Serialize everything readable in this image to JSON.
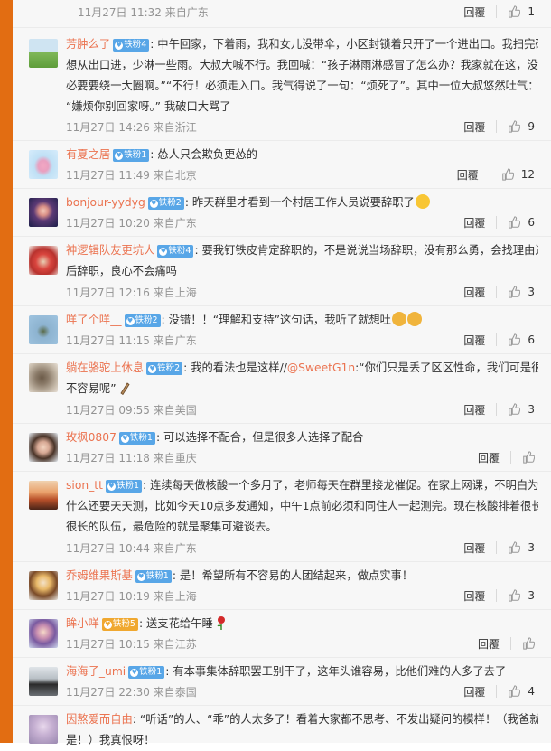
{
  "top_item": {
    "meta": "11月27日 11:32 来自广东",
    "reply": "回覆",
    "likes": "1"
  },
  "comments": [
    {
      "user": "芳肿么了",
      "badge": "铁粉4",
      "lines": [
        ": 中午回家，下着雨，我和女儿没带伞，小区封锁着只开了一个进出口。我扫完码",
        "想从出口进，少淋一些雨。大叔大喊不行。我回喊：“孩子淋雨淋感冒了怎么办？我家就在这，没",
        "必要要绕一大圈啊。”“不行！必须走入口。我气得说了一句：“烦死了”。其中一位大叔悠然吐气：",
        "“嫌烦你别回家呀。” 我破口大骂了"
      ],
      "meta": "11月27日 14:26 来自浙江",
      "reply": "回覆",
      "likes": "9"
    },
    {
      "user": "有夏之居",
      "badge": "铁粉1",
      "lines": [
        ": 怂人只会欺负更怂的"
      ],
      "meta": "11月27日 11:49 来自北京",
      "reply": "回覆",
      "likes": "12"
    },
    {
      "user": "bonjour-yydyg",
      "badge": "铁粉2",
      "lines": [
        ": 昨天群里才看到一个村居工作人员说要辞职了"
      ],
      "meta": "11月27日 10:20 来自广东",
      "reply": "回覆",
      "likes": "6"
    },
    {
      "user": "神逻辑队友更坑人",
      "badge": "铁粉4",
      "lines": [
        ": 要我钉铁皮肯定辞职的，不是说说当场辞职，没有那么勇，会找理由过",
        "后辞职，良心不会痛吗"
      ],
      "meta": "11月27日 12:16 来自上海",
      "reply": "回覆",
      "likes": "3"
    },
    {
      "user": "咩了个咩__",
      "badge": "铁粉2",
      "lines": [
        ": 没错！！“理解和支持”这句话，我听了就想吐"
      ],
      "meta": "11月27日 11:15 来自广东",
      "reply": "回覆",
      "likes": "6"
    },
    {
      "user": "躺在骆驼上休息",
      "badge": "铁粉2",
      "lines_rich": [
        ": 我的看法也是这样//",
        "@SweetG1n",
        ":“你们只是丢了区区性命，我们可是很"
      ],
      "lines": [
        "不容易呢”"
      ],
      "meta": "11月27日 09:55 来自美国",
      "reply": "回覆",
      "likes": "3"
    },
    {
      "user": "玫枫0807",
      "badge": "铁粉1",
      "lines": [
        ": 可以选择不配合，但是很多人选择了配合"
      ],
      "meta": "11月27日 11:18 来自重庆",
      "reply": "回覆",
      "likes": ""
    },
    {
      "user": "sion_tt",
      "badge": "铁粉1",
      "lines": [
        ": 连续每天做核酸一个多月了，老师每天在群里接龙催促。在家上网课，不明白为",
        "什么还要天天测，比如今天10点多发通知，中午1点前必须和同住人一起测完。现在核酸排着很长",
        "很长的队伍，最危险的就是聚集可避谈去。"
      ],
      "meta": "11月27日 10:44 来自广东",
      "reply": "回覆",
      "likes": "3"
    },
    {
      "user": "乔姆维果斯基",
      "badge": "铁粉1",
      "lines": [
        ": 是！希望所有不容易的人团结起来，做点实事！"
      ],
      "meta": "11月27日 10:19 来自上海",
      "reply": "回覆",
      "likes": "3"
    },
    {
      "user": "眸小咩",
      "badge": "铁粉5",
      "lines": [
        ": 送支花给午睡"
      ],
      "meta": "11月27日 10:15 来自江苏",
      "reply": "回覆",
      "likes": ""
    },
    {
      "user": "海海子_umi",
      "badge": "铁粉1",
      "lines": [
        ": 有本事集体辞职罢工别干了，这年头谁容易，比他们难的人多了去了"
      ],
      "meta": "11月27日 22:30 来自泰国",
      "reply": "回覆",
      "likes": "4"
    },
    {
      "user": "因熬爱而自由",
      "badge": "",
      "lines": [
        ": “听话”的人、“乖”的人太多了！看着大家都不思考、不发出疑问的模样！（我爸就",
        "是！）我真恨呀！"
      ],
      "meta": "",
      "reply": "",
      "likes": ""
    }
  ],
  "colors": {
    "stripe": "#e26d12",
    "username": "#eb7350",
    "badge": "#58a6e7",
    "meta": "#939393"
  }
}
